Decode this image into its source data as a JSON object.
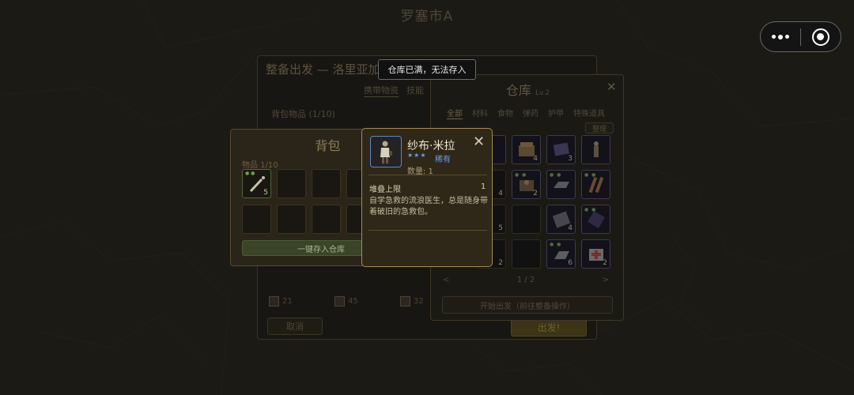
{
  "city_title": "罗塞市A",
  "capsule": {
    "menu_icon": "more-dots-icon",
    "close_icon": "target-icon"
  },
  "toast": "仓库已满，无法存入",
  "equip_panel": {
    "title": "整备出发 — 洛里亚加",
    "tabs": [
      "携带物资",
      "技能"
    ],
    "bag_items_label": "背包物品 (1/10)",
    "checkboxes": [
      "21",
      "45",
      "32"
    ],
    "cancel_label": "取消",
    "depart_label": "出发!"
  },
  "warehouse": {
    "title": "仓库",
    "level": "Lv.2",
    "tabs": [
      "全部",
      "材料",
      "食物",
      "弹药",
      "护甲",
      "特殊道具"
    ],
    "sort_label": "整理",
    "page": "1 / 2",
    "prev": "<",
    "next": ">",
    "bottom_label": "开始出发（前往整备操作）",
    "slots": [
      {
        "count": ""
      },
      {
        "count": ""
      },
      {
        "count": "4"
      },
      {
        "count": "3"
      },
      {
        "count": ""
      },
      {
        "count": "4"
      },
      {
        "count": "2"
      },
      {
        "count": ""
      },
      {
        "count": ""
      },
      {
        "count": "5"
      },
      {
        "count": ""
      },
      {
        "count": "4"
      },
      {
        "count": ""
      },
      {
        "count": "2"
      },
      {
        "count": ""
      },
      {
        "count": "6"
      },
      {
        "count": "2"
      }
    ]
  },
  "backpack": {
    "title": "背包",
    "items_label": "物品 1/10",
    "first_slot_count": "5",
    "store_all_label": "一键存入仓库"
  },
  "tooltip": {
    "name": "纱布·米拉",
    "stars": "★★★",
    "rarity": "稀有",
    "quantity": "数量: 1",
    "stack_label": "堆叠上限",
    "stack_value": "1",
    "description": "自学急救的流浪医生，总是随身带着破旧的急救包。",
    "close_icon": "close-icon"
  }
}
